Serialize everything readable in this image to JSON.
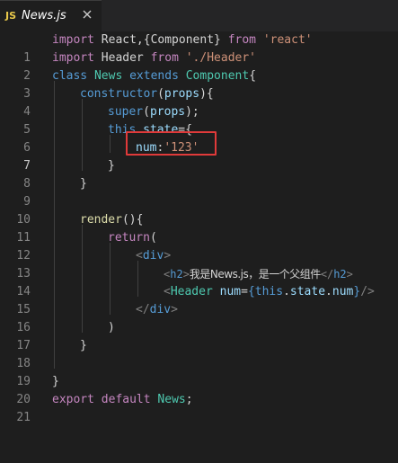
{
  "tab": {
    "icon_text": "JS",
    "file_name": "News.js",
    "close_icon": "close-icon"
  },
  "editor": {
    "highlight_color": "#e03a3a",
    "lines": [
      {
        "n": "1"
      },
      {
        "n": "2"
      },
      {
        "n": "3"
      },
      {
        "n": "4"
      },
      {
        "n": "5"
      },
      {
        "n": "6"
      },
      {
        "n": "7"
      },
      {
        "n": "8"
      },
      {
        "n": "9"
      },
      {
        "n": "10"
      },
      {
        "n": "11"
      },
      {
        "n": "12"
      },
      {
        "n": "13"
      },
      {
        "n": "14"
      },
      {
        "n": "15"
      },
      {
        "n": "16"
      },
      {
        "n": "17"
      },
      {
        "n": "18"
      },
      {
        "n": "19"
      },
      {
        "n": "20"
      },
      {
        "n": "21"
      }
    ],
    "tokens": {
      "l1": [
        "import",
        " React,{Component} ",
        "from",
        " ",
        "'react'"
      ],
      "l2": [
        "import",
        " Header ",
        "from",
        " ",
        "'./Header'"
      ],
      "l3": [
        "class",
        " ",
        "News",
        " ",
        "extends",
        " ",
        "Component",
        "{"
      ],
      "l4": [
        "constructor",
        "(",
        "props",
        "){"
      ],
      "l5": [
        "super",
        "(",
        "props",
        ");"
      ],
      "l6": [
        "this",
        ".",
        "state",
        "={"
      ],
      "l7": [
        "num",
        ":",
        "'123'"
      ],
      "l8": [
        "}"
      ],
      "l9": [
        "}"
      ],
      "l11": [
        "render",
        "(){"
      ],
      "l12": [
        "return",
        "("
      ],
      "l13": [
        "<",
        "div",
        ">"
      ],
      "l14": [
        "<",
        "h2",
        ">",
        "我是News.js，是一个父组件",
        "</",
        "h2",
        ">"
      ],
      "l15": [
        "<",
        "Header",
        " ",
        "num",
        "=",
        "{",
        "this",
        ".",
        "state",
        ".",
        "num",
        "}",
        "/>"
      ],
      "l16": [
        "</",
        "div",
        ">"
      ],
      "l17": [
        ")"
      ],
      "l18": [
        "}"
      ],
      "l20": [
        "}"
      ],
      "l21": [
        "export",
        " ",
        "default",
        " ",
        "News",
        ";"
      ]
    }
  }
}
